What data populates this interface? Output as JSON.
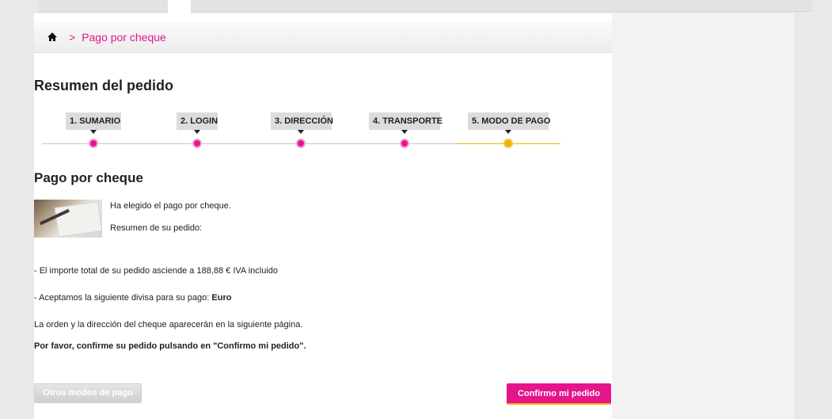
{
  "breadcrumb": {
    "separator": ">",
    "current": "Pago por cheque"
  },
  "page_title": "Resumen del pedido",
  "steps": [
    {
      "label": "1. SUMARIO",
      "state": "done"
    },
    {
      "label": "2. LOGIN",
      "state": "done"
    },
    {
      "label": "3. DIRECCIÓN",
      "state": "done"
    },
    {
      "label": "4. TRANSPORTE",
      "state": "done"
    },
    {
      "label": "5. MODO DE PAGO",
      "state": "current"
    }
  ],
  "section_title": "Pago por cheque",
  "payment": {
    "chosen_text": "Ha elegido el pago por cheque.",
    "summary_text": "Resumen de su pedido:",
    "total_prefix": "- El importe total de su pedido asciende a ",
    "total_amount": "188,88 €",
    "total_suffix": " IVA incluido",
    "currency_prefix": "- Aceptamos la siguiente divisa para su pago: ",
    "currency": "Euro",
    "next_page_text": "La orden y la dirección del cheque aparecerán en la siguiente página.",
    "confirm_hint": "Por favor, confirme su pedido pulsando en \"Confirmo mi pedido\"."
  },
  "buttons": {
    "other_methods": "Otros modos de pago",
    "confirm": "Confirmo mi pedido"
  },
  "colors": {
    "accent": "#e5158c",
    "current_step": "#f0b400"
  },
  "icons": {
    "home": "home-icon"
  }
}
